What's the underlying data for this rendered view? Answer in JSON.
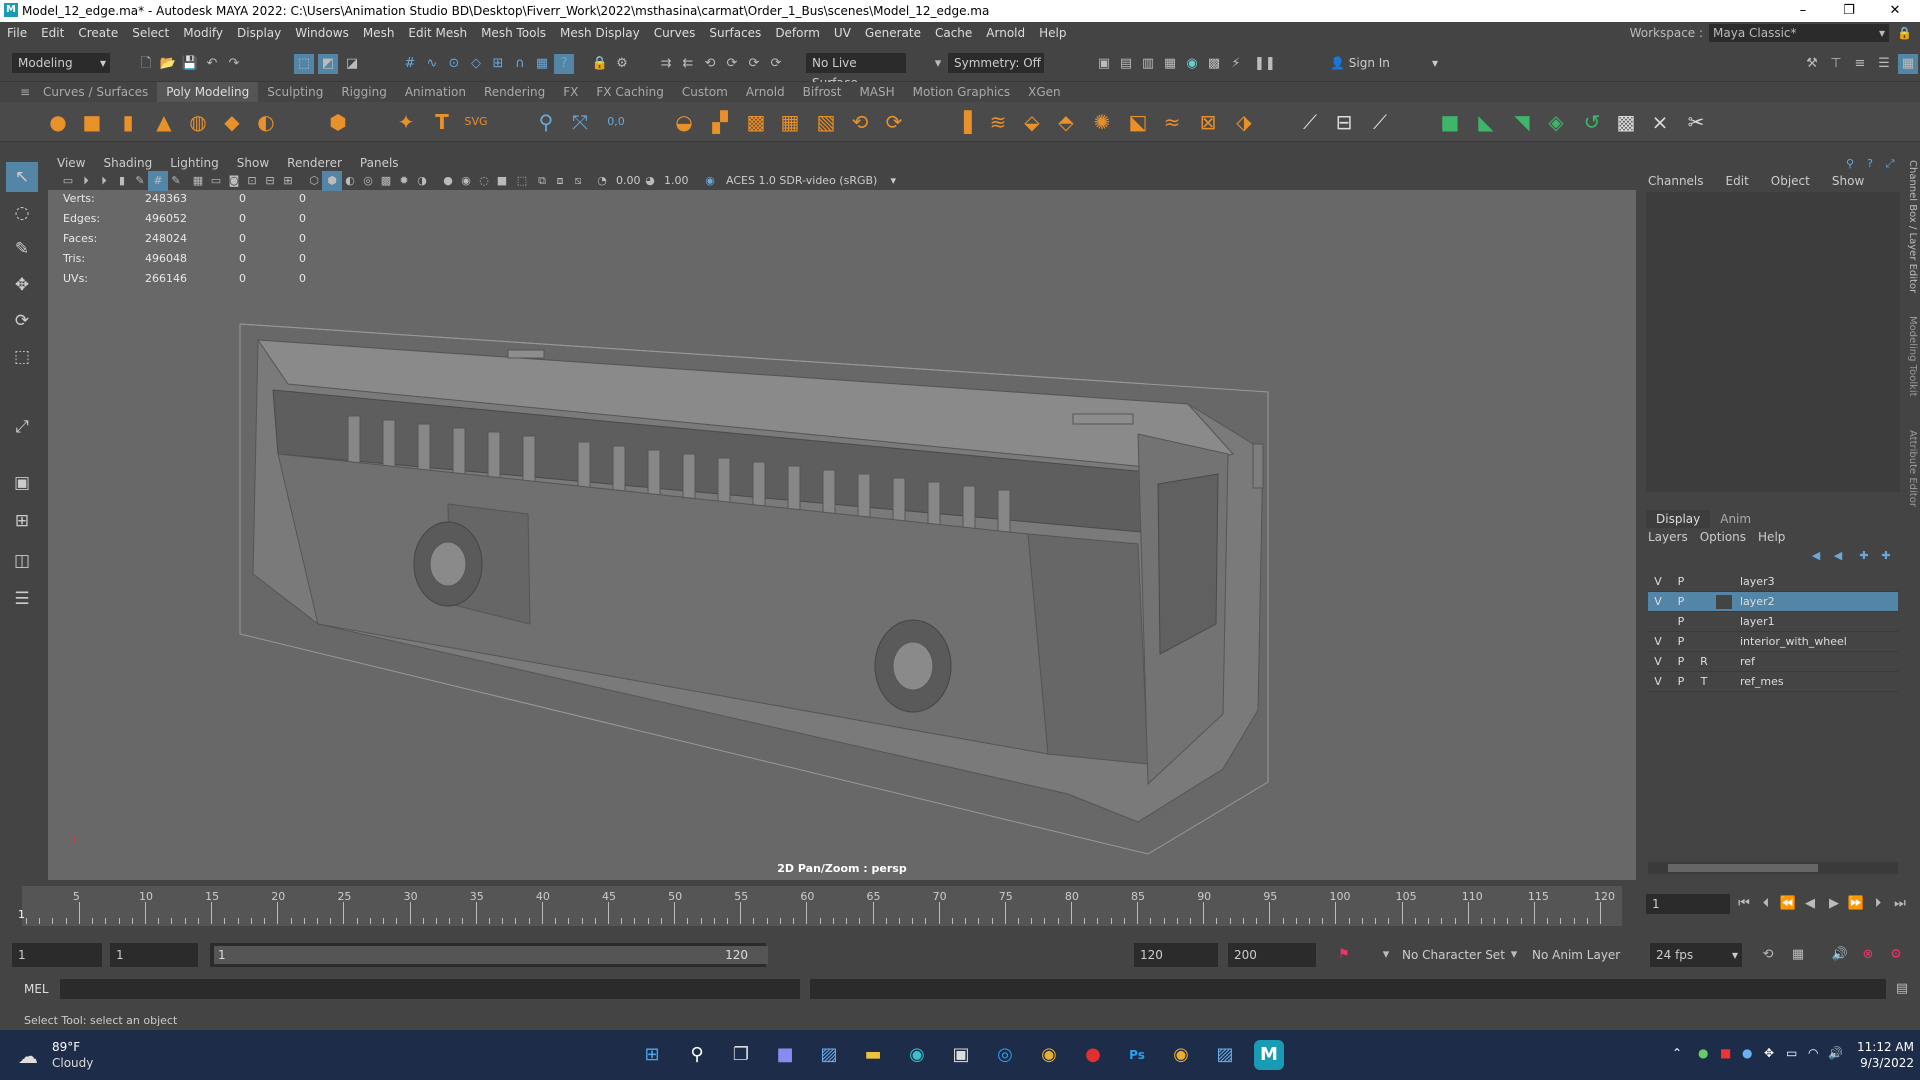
{
  "window": {
    "title": "Model_12_edge.ma* - Autodesk MAYA 2022: C:\\Users\\Animation Studio BD\\Desktop\\Fiverr_Work\\2022\\msthasina\\carmat\\Order_1_Bus\\scenes\\Model_12_edge.ma"
  },
  "menus": [
    "File",
    "Edit",
    "Create",
    "Select",
    "Modify",
    "Display",
    "Windows",
    "Mesh",
    "Edit Mesh",
    "Mesh Tools",
    "Mesh Display",
    "Curves",
    "Surfaces",
    "Deform",
    "UV",
    "Generate",
    "Cache",
    "Arnold",
    "Help"
  ],
  "workspace": {
    "label": "Workspace :",
    "value": "Maya Classic*"
  },
  "status": {
    "mode": "Modeling",
    "live_surface": "No Live Surface",
    "symmetry": "Symmetry: Off",
    "sign_in": "Sign In"
  },
  "shelf_tabs": [
    "Curves / Surfaces",
    "Poly Modeling",
    "Sculpting",
    "Rigging",
    "Animation",
    "Rendering",
    "FX",
    "FX Caching",
    "Custom",
    "Arnold",
    "Bifrost",
    "MASH",
    "Motion Graphics",
    "XGen"
  ],
  "shelf_active": "Poly Modeling",
  "viewport": {
    "menus": [
      "View",
      "Shading",
      "Lighting",
      "Show",
      "Renderer",
      "Panels"
    ],
    "exposure": "0.00",
    "gamma": "1.00",
    "colorspace": "ACES 1.0 SDR-video (sRGB)",
    "camera_label": "2D Pan/Zoom : persp",
    "hud": [
      {
        "label": "Verts:",
        "v1": "248363",
        "v2": "0",
        "v3": "0"
      },
      {
        "label": "Edges:",
        "v1": "496052",
        "v2": "0",
        "v3": "0"
      },
      {
        "label": "Faces:",
        "v1": "248024",
        "v2": "0",
        "v3": "0"
      },
      {
        "label": "Tris:",
        "v1": "496048",
        "v2": "0",
        "v3": "0"
      },
      {
        "label": "UVs:",
        "v1": "266146",
        "v2": "0",
        "v3": "0"
      }
    ]
  },
  "channel_box": {
    "tabs": [
      "Channels",
      "Edit",
      "Object",
      "Show"
    ]
  },
  "side_labels": [
    "Channel Box / Layer Editor",
    "Modeling Toolkit",
    "Attribute Editor"
  ],
  "layer_editor": {
    "tabs": [
      "Display",
      "Anim"
    ],
    "menus": [
      "Layers",
      "Options",
      "Help"
    ],
    "layers": [
      {
        "v": "V",
        "p": "P",
        "r": "",
        "name": "layer3",
        "selected": false
      },
      {
        "v": "V",
        "p": "P",
        "r": "",
        "name": "layer2",
        "selected": true
      },
      {
        "v": "",
        "p": "P",
        "r": "",
        "name": "layer1",
        "selected": false
      },
      {
        "v": "V",
        "p": "P",
        "r": "",
        "name": "interior_with_wheel",
        "selected": false
      },
      {
        "v": "V",
        "p": "P",
        "r": "R",
        "name": "ref",
        "selected": false
      },
      {
        "v": "V",
        "p": "P",
        "r": "T",
        "name": "ref_mes",
        "selected": false
      }
    ]
  },
  "timeline": {
    "ticks": [
      "5",
      "10",
      "15",
      "20",
      "25",
      "30",
      "35",
      "40",
      "45",
      "50",
      "55",
      "60",
      "65",
      "70",
      "75",
      "80",
      "85",
      "90",
      "95",
      "100",
      "105",
      "110",
      "115",
      "120"
    ],
    "current": "1",
    "current_frame_field": "1"
  },
  "range": {
    "start": "1",
    "anim_start": "1",
    "slider_start": "1",
    "slider_end": "120",
    "end": "120",
    "anim_end": "200",
    "char_set": "No Character Set",
    "anim_layer": "No Anim Layer",
    "fps": "24 fps"
  },
  "command": {
    "label": "MEL"
  },
  "help_line": "Select Tool: select an object",
  "taskbar": {
    "weather_temp": "89°F",
    "weather_desc": "Cloudy",
    "time": "11:12 AM",
    "date": "9/3/2022"
  },
  "colors": {
    "selection": "#5285a6",
    "viewport_bg": "#686868",
    "accent_orange": "#e8902a",
    "accent_green": "#3fb56a"
  }
}
